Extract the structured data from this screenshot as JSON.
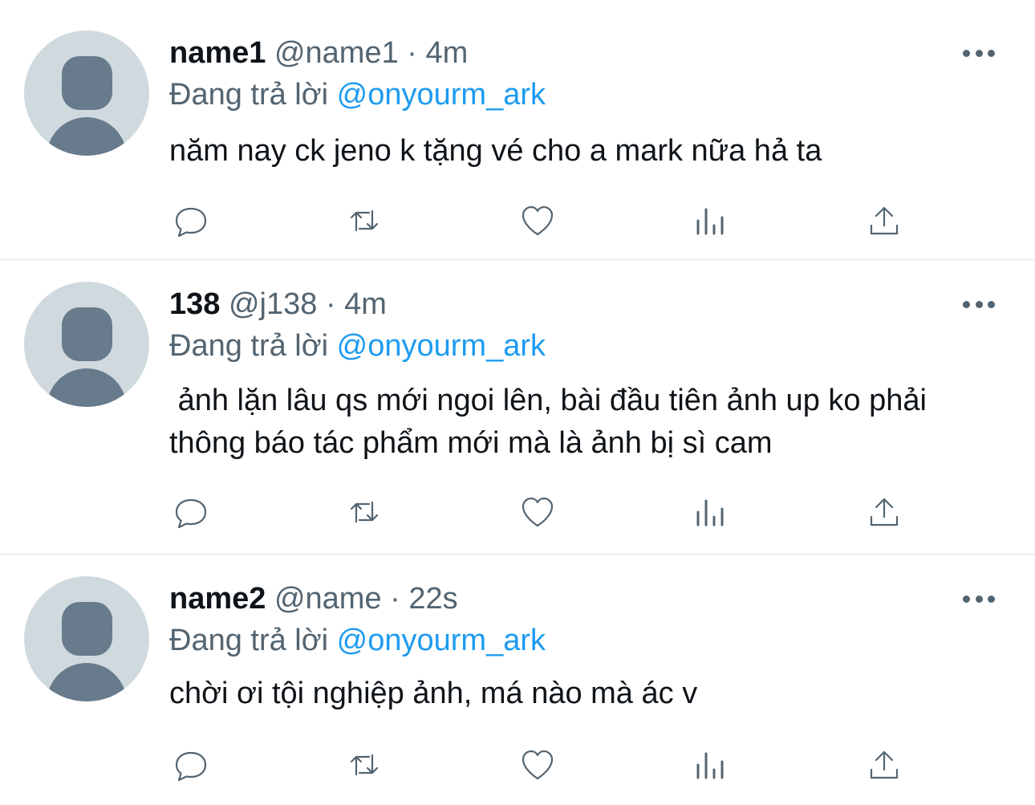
{
  "tweets": [
    {
      "display_name": "name1",
      "handle": "@name1",
      "separator": "·",
      "time": "4m",
      "reply_prefix": "Đang trả lời",
      "reply_to": "@onyourm_ark",
      "text": "năm nay ck jeno k tặng vé cho a mark nữa hả ta"
    },
    {
      "display_name": "138",
      "handle": "@j138",
      "separator": "·",
      "time": "4m",
      "reply_prefix": "Đang trả lời",
      "reply_to": "@onyourm_ark",
      "text": " ảnh lặn lâu qs mới ngoi lên, bài đầu tiên ảnh up ko phải thông báo tác phẩm mới mà là ảnh bị sì cam"
    },
    {
      "display_name": "name2",
      "handle": "@name",
      "separator": "·",
      "time": "22s",
      "reply_prefix": "Đang trả lời",
      "reply_to": "@onyourm_ark",
      "text": "chời ơi tội nghiệp ảnh, má nào mà ác v"
    }
  ],
  "icons": {
    "more": "more-horizontal-icon",
    "reply": "reply-bubble-icon",
    "retweet": "retweet-icon",
    "like": "heart-icon",
    "views": "bar-chart-icon",
    "share": "share-upload-icon"
  },
  "colors": {
    "link": "#1d9bf0",
    "secondary_text": "#536471",
    "primary_text": "#0f1419",
    "avatar_bg": "#cfd9de",
    "avatar_fg": "#687b8c",
    "divider": "#eff1f3"
  }
}
